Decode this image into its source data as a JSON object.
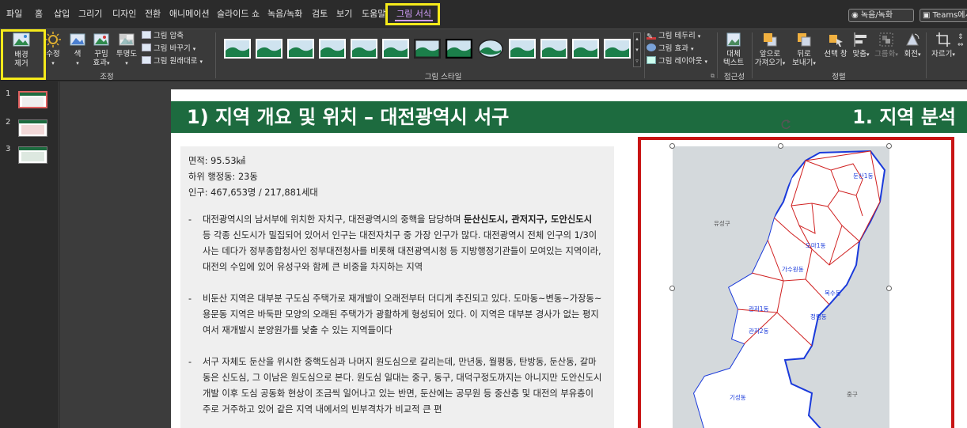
{
  "menu": {
    "tabs": [
      "파일",
      "홈",
      "삽입",
      "그리기",
      "디자인",
      "전환",
      "애니메이션",
      "슬라이드 쇼",
      "녹음/녹화",
      "검토",
      "보기",
      "도움말",
      "그림 서식"
    ],
    "active_tab": "그림 서식",
    "record_button": "녹음/녹화",
    "teams_button": "Teams에서 프레"
  },
  "ribbon": {
    "remove_bg": [
      "배경",
      "제거"
    ],
    "corrections": "수정",
    "color": "색",
    "artistic_effects": [
      "꾸밈",
      "효과"
    ],
    "transparency": "투명도",
    "compress": "그림 압축",
    "change_picture": "그림 바꾸기",
    "reset_picture": "그림 원래대로",
    "adjust_group": "조정",
    "picture_styles_group": "그림 스타일",
    "border": "그림 테두리",
    "effects": "그림 효과",
    "layout": "그림 레이아웃",
    "alt_text": [
      "대체",
      "텍스트"
    ],
    "accessibility_group": "접근성",
    "bring_forward": [
      "앞으로",
      "가져오기"
    ],
    "send_backward": [
      "뒤로",
      "보내기"
    ],
    "selection_pane": "선택 창",
    "align": "맞춤",
    "group": "그룹화",
    "rotate": "회전",
    "arrange_group": "정렬",
    "crop": "자르기"
  },
  "slides": [
    "1",
    "2",
    "3"
  ],
  "slide": {
    "title": "1) 지역 개요 및 위치 – 대전광역시 서구",
    "section": "1. 지역 분석",
    "stats": [
      "면적: 95.53㎢",
      "하위 행정동: 23동",
      "인구: 467,653명 / 217,881세대"
    ],
    "para1_prefix": "대전광역시의 남서부에 위치한 자치구, 대전광역시의 중핵을 담당하며 ",
    "para1_bold": "둔산신도시, 관저지구, 도안신도시",
    "para1_suffix": " 등 각종 신도시가 밀집되어 있어서 인구는 대전자치구 중 가장 인구가 많다. 대전광역시 전체 인구의 1/3이 사는 데다가 정부종합청사인 정부대전청사를 비롯해 대전광역시청 등 지방행정기관들이 모여있는 지역이라, 대전의 수입에 있어 유성구와 함께 큰 비중을 차지하는 지역",
    "para2": "비둔산 지역은 대부분 구도심 주택가로 재개발이 오래전부터 더디게 추진되고 있다. 도마동~변동~가장동~용문동 지역은 바둑판 모양의 오래된 주택가가 광활하게 형성되어 있다. 이 지역은 대부분 경사가 없는 평지여서 재개발시 분양원가를 낮출 수 있는 지역들이다",
    "para3": "서구 자체도 둔산을 위시한 중핵도심과 나머지 원도심으로 갈리는데, 만년동, 월평동, 탄방동, 둔산동, 갈마동은 신도심, 그 이남은 원도심으로 본다. 원도심 일대는 중구, 동구, 대덕구정도까지는 아니지만 도안신도시 개발 이후 도심 공동화 현상이 조금씩 일어나고 있는 반면, 둔산에는 공무원 등 중산층 및 대전의 부유층이 주로 거주하고 있어 같은 지역 내에서의 빈부격차가 비교적 큰 편",
    "dash": "-"
  },
  "map": {
    "label_yuseong": "유성구",
    "label_junggu": "중구",
    "label_gasuwon": "가수원동",
    "label_gwanjeo1": "관저1동",
    "label_gwanjeo2": "관저2동",
    "label_gisoeng": "기성동",
    "label_bokgu": "복수동",
    "label_jeongrim": "정림동",
    "label_doma": "도마1동",
    "label_dunsan": "둔산1동"
  },
  "colors": {
    "title_bar": "#1d6b3f",
    "highlight": "#f5ea1a",
    "map_frame": "#c81414",
    "active_tab": "#d4a0ff"
  }
}
